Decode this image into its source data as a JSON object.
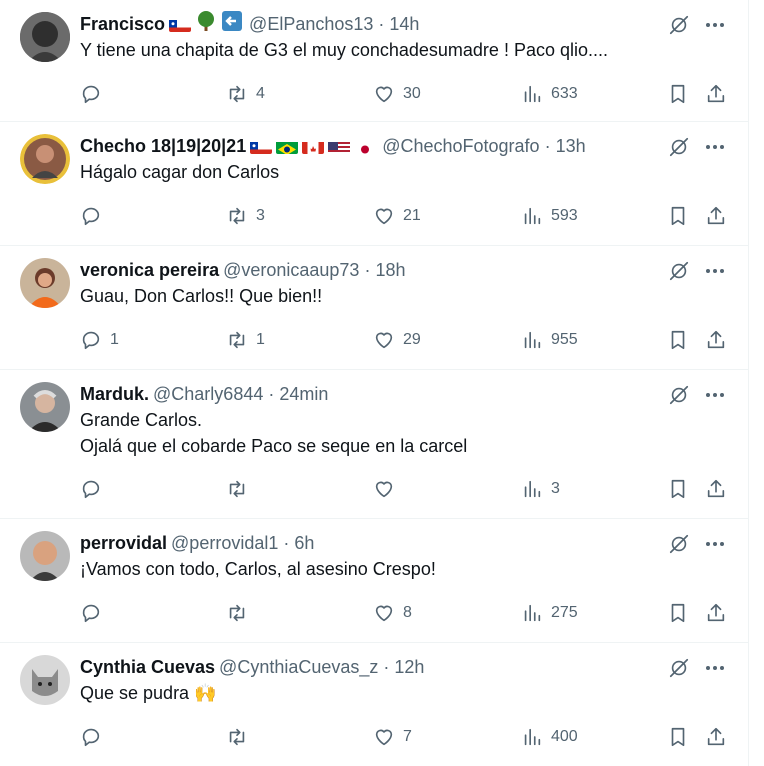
{
  "replies": [
    {
      "name": "Francisco",
      "handle": "@ElPanchos13",
      "time": "14h",
      "text": "Y tiene una chapita de G3 el muy conchadesumadre ! Paco qlio....",
      "flags": [
        "chile",
        "tree",
        "back-arrow"
      ],
      "replies": "",
      "retweets": "4",
      "likes": "30",
      "views": "633"
    },
    {
      "name": "Checho 18|19|20|21",
      "handle": "@ChechoFotografo",
      "time": "13h",
      "text": "Hágalo cagar don Carlos",
      "flags": [
        "chile",
        "brazil",
        "canada",
        "usa",
        "japan"
      ],
      "replies": "",
      "retweets": "3",
      "likes": "21",
      "views": "593"
    },
    {
      "name": "veronica pereira",
      "handle": "@veronicaaup73",
      "time": "18h",
      "text": "Guau, Don Carlos!! Que bien!!",
      "flags": [],
      "replies": "1",
      "retweets": "1",
      "likes": "29",
      "views": "955"
    },
    {
      "name": "Marduk.",
      "handle": "@Charly6844",
      "time": "24min",
      "text": "Grande Carlos.\nOjalá que el cobarde Paco se seque en la carcel",
      "flags": [],
      "replies": "",
      "retweets": "",
      "likes": "",
      "views": "3"
    },
    {
      "name": "perrovidal",
      "handle": "@perrovidal1",
      "time": "6h",
      "text": "¡Vamos con todo, Carlos, al asesino Crespo!",
      "flags": [],
      "replies": "",
      "retweets": "",
      "likes": "8",
      "views": "275"
    },
    {
      "name": "Cynthia Cuevas",
      "handle": "@CynthiaCuevas_z",
      "time": "12h",
      "text": "Que se pudra 🙌",
      "flags": [],
      "replies": "",
      "retweets": "",
      "likes": "7",
      "views": "400"
    }
  ],
  "dot": "·",
  "colors": {
    "text": "#0f1419",
    "muted": "#536471",
    "border": "#eff3f4"
  }
}
